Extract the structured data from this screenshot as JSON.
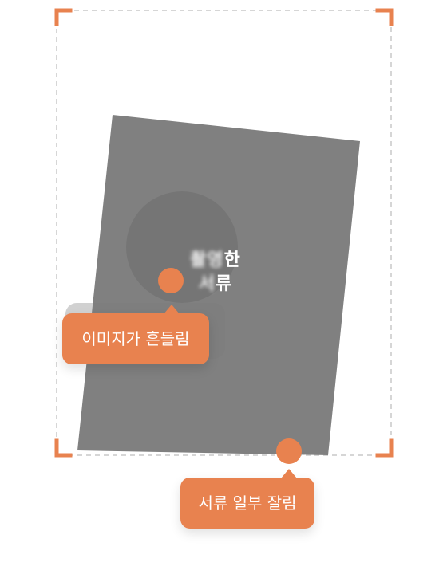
{
  "diagram": {
    "document_label": {
      "line1_blurred": "촬영",
      "line1_clear": "한",
      "line2_blurred": "서",
      "line2_clear": "류"
    },
    "callouts": {
      "shake": "이미지가 흔들림",
      "cropped": "서류 일부 잘림"
    },
    "colors": {
      "accent": "#e8824f",
      "document": "#808080",
      "shake_circle": "#757575",
      "frame_dash": "#c8c8c8",
      "frame_corner": "#e8824f"
    },
    "icons": {
      "marker": "marker-dot-icon",
      "corner": "corner-bracket-icon"
    }
  }
}
